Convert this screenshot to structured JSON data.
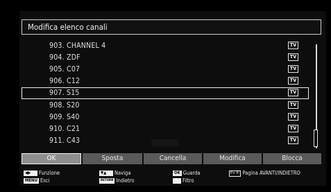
{
  "title": "Modifica elenco canali",
  "channels": [
    {
      "label": "903. CHANNEL 4",
      "type": "TV"
    },
    {
      "label": "904. ZDF",
      "type": "TV"
    },
    {
      "label": "905. C07",
      "type": "TV"
    },
    {
      "label": "906. C12",
      "type": "TV"
    },
    {
      "label": "907. S15",
      "type": "TV",
      "selected": true
    },
    {
      "label": "908. S20",
      "type": "TV"
    },
    {
      "label": "909. S40",
      "type": "TV"
    },
    {
      "label": "910. C21",
      "type": "TV"
    },
    {
      "label": "911. C43",
      "type": "TV"
    }
  ],
  "buttons": [
    {
      "label": "OK",
      "active": true
    },
    {
      "label": "Sposta"
    },
    {
      "label": "Cancella"
    },
    {
      "label": "Modifica"
    },
    {
      "label": "Blocca"
    }
  ],
  "help": {
    "funzione": "Funzione",
    "esci": "Esci",
    "naviga": "Naviga",
    "indietro": "Indietro",
    "guarda": "Guarda",
    "filtro": "Filtro",
    "pagina": "Pagina AVANTI/INDIETRO",
    "key_menu": "MENU",
    "key_ok": "OK",
    "key_return": "RETURN",
    "key_pp": "P+ P-"
  }
}
